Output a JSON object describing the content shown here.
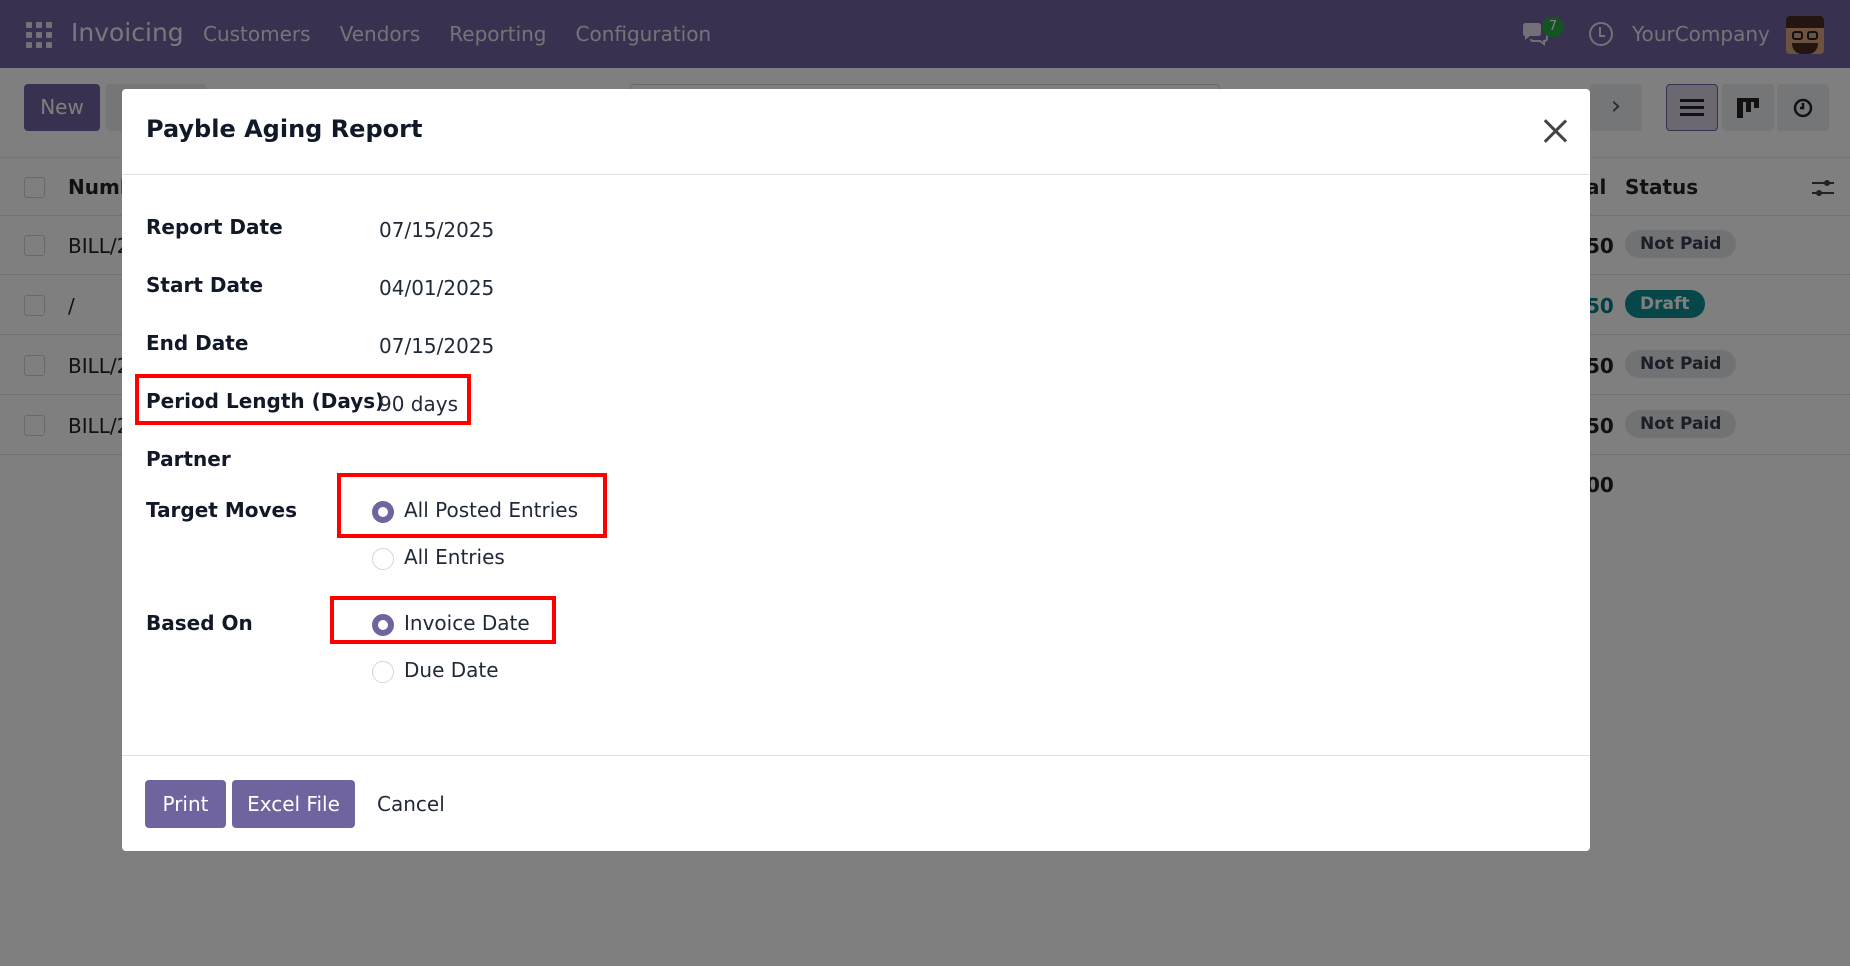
{
  "navbar": {
    "app_name": "Invoicing",
    "menu": [
      "Customers",
      "Vendors",
      "Reporting",
      "Configuration"
    ],
    "chat_count": "7",
    "company": "YourCompany"
  },
  "control_panel": {
    "new_label": "New"
  },
  "list": {
    "headers": {
      "number": "Numb",
      "total": "al",
      "status": "Status"
    },
    "rows": [
      {
        "number": "BILL/2",
        "total": "50",
        "status": "Not Paid"
      },
      {
        "number": "/",
        "total": "50",
        "status": "Draft"
      },
      {
        "number": "BILL/2",
        "total": "50",
        "status": "Not Paid"
      },
      {
        "number": "BILL/2",
        "total": "50",
        "status": "Not Paid"
      }
    ],
    "grand_total": "00"
  },
  "dialog": {
    "title": "Payble Aging Report",
    "fields": {
      "report_date": {
        "label": "Report Date",
        "value": "07/15/2025"
      },
      "start_date": {
        "label": "Start Date",
        "value": "04/01/2025"
      },
      "end_date": {
        "label": "End Date",
        "value": "07/15/2025"
      },
      "period_length": {
        "label": "Period Length (Days)",
        "value": "90 days"
      },
      "partner": {
        "label": "Partner",
        "value": ""
      },
      "target_moves": {
        "label": "Target Moves",
        "options": [
          "All Posted Entries",
          "All Entries"
        ],
        "selected": "All Posted Entries"
      },
      "based_on": {
        "label": "Based On",
        "options": [
          "Invoice Date",
          "Due Date"
        ],
        "selected": "Invoice Date"
      }
    },
    "buttons": {
      "print": "Print",
      "excel": "Excel File",
      "cancel": "Cancel"
    }
  },
  "colors": {
    "brand": "#71639e",
    "highlight": "#ff0000",
    "draft_badge": "#0e8f93"
  }
}
